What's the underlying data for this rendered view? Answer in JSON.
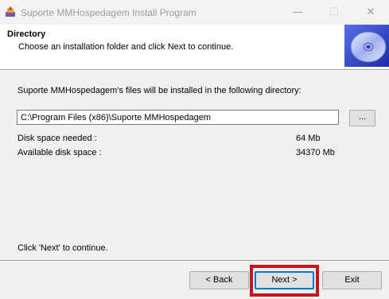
{
  "window": {
    "title": "Suporte MMHospedagem Install Program",
    "controls": {
      "minimize": "—",
      "maximize": "☐",
      "close": "✕"
    }
  },
  "header": {
    "title": "Directory",
    "subtitle": "Choose an installation folder and click Next to continue.",
    "icon": "cd-disc-icon"
  },
  "body": {
    "intro": "Suporte MMHospedagem's files will be installed in the following directory:",
    "path_value": "C:\\Program Files (x86)\\Suporte MMHospedagem",
    "browse_label": "...",
    "disk_needed_label": "Disk space needed :",
    "disk_needed_value": "64 Mb",
    "disk_available_label": "Available disk space :",
    "disk_available_value": "34370 Mb",
    "footer_text": "Click 'Next' to continue."
  },
  "buttons": {
    "back": "< Back",
    "next": "Next >",
    "exit": "Exit"
  },
  "colors": {
    "highlight": "#c8151d",
    "focus": "#0078d7",
    "background": "#f0f0f0"
  }
}
